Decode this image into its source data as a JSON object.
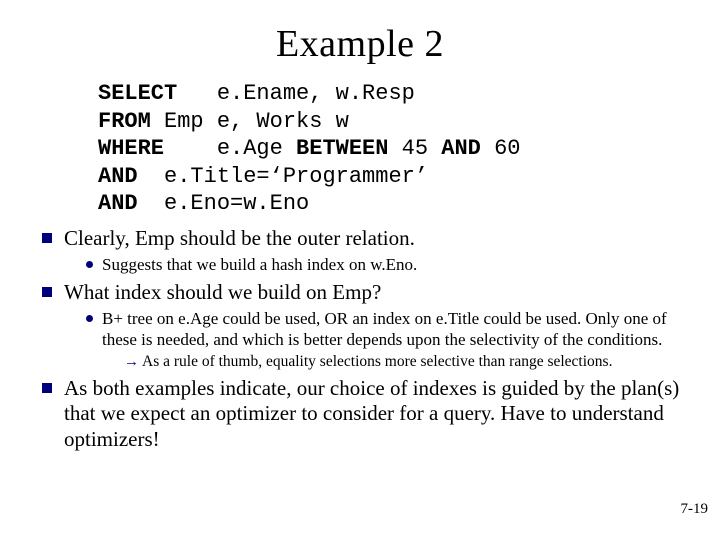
{
  "title": "Example 2",
  "code": {
    "line1_kw": "SELECT",
    "line1_rest": "   e.Ename, w.Resp",
    "line2_kw": "FROM",
    "line2_rest": " Emp e, Works w",
    "line3_kw": "WHERE",
    "line3_rest": "    e.Age ",
    "line3_kw2": "BETWEEN",
    "line3_mid": " 45 ",
    "line3_kw3": "AND",
    "line3_end": " 60",
    "line4_kw": "AND",
    "line4_rest": "  e.Title=‘Programmer’",
    "line5_kw": "AND",
    "line5_rest": "  e.Eno=w.Eno"
  },
  "b1": "Clearly, Emp should be the outer relation.",
  "b1_sub": "Suggests that we build a hash index on w.Eno.",
  "b2": "What index should we build on Emp?",
  "b2_sub": "B+ tree on e.Age could be used, OR an index on e.Title could be used. Only one of these is needed, and which is better depends upon the selectivity of the conditions.",
  "b2_arrow": "As a rule of thumb, equality selections more selective than range selections.",
  "b3": "As both examples indicate, our choice of indexes is guided by the plan(s) that we expect an optimizer to consider for a query. Have to understand optimizers!",
  "page_number": "7-19"
}
